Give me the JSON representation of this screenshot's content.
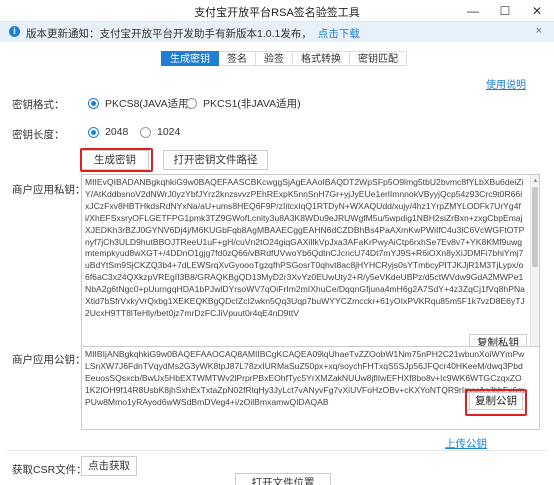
{
  "window": {
    "title": "支付宝开放平台RSA签名验签工具",
    "minimize_glyph": "—",
    "maximize_glyph": "☐",
    "close_glyph": "✕"
  },
  "notice": {
    "text": "版本更新通知：支付宝开放平台开发助手有新版本1.0.1发布，",
    "link": "点击下载",
    "close_glyph": "×"
  },
  "tabs": [
    {
      "label": "生成密钥",
      "active": true
    },
    {
      "label": "签名",
      "active": false
    },
    {
      "label": "验签",
      "active": false
    },
    {
      "label": "格式转换",
      "active": false
    },
    {
      "label": "密钥匹配",
      "active": false
    }
  ],
  "help_link": "使用说明",
  "key_format": {
    "label": "密钥格式：",
    "options": [
      {
        "label": "PKCS8(JAVA适用)",
        "selected": true
      },
      {
        "label": "PKCS1(非JAVA适用)",
        "selected": false
      }
    ]
  },
  "key_length": {
    "label": "密钥长度：",
    "options": [
      {
        "label": "2048",
        "selected": true
      },
      {
        "label": "1024",
        "selected": false
      }
    ]
  },
  "buttons": {
    "generate": "生成密钥",
    "open_path": "打开密钥文件路径",
    "copy_private": "复制私钥",
    "copy_public": "复制公钥",
    "get_csr": "点击获取",
    "open_file_location": "打开文件位置"
  },
  "private_key": {
    "label": "商户应用私钥：",
    "value": "MIIEvQIBADANBgkqhkiG9w0BAQEFAASCBKcwggSjAgEAAoIBAQDT2WpSFp5O9lmg5tbU2bvmc8fYLbXBu6deiZiY/AtKddbsnoV2dNWrJ0yzYbfJYrz2knzsvvzPEhRExpK5nnSnH7Gr+yjJyEUe1erlImnnokVByyjQcp54z93Crc9t0R66ixJCzFxv8HBTHkdsRdNYxNa/aU+ums8HEQ6F9P/zIitcxIqQ1RTDyN+WXAQUdd/xujy/4hz1YrpZMYLODFk7UrYg4fi/XhEFSxsryOFLGETFPG1pmk3TZ9GWofLcnity3u8A3K8WDu9eJRUWgfM5u/5wpdig1NBH2siZrBxn+zxgCbpEmajXJEDKh3rBZJ0GYNV6Dj4j/M6KUGbFqb8AgMBAAECggEAHN6dCZDBhBs4PaAXmKwPWiIfC4u3lC6VcWGFtOTPnyf7jCh3ULD9hutBBOJTReeU1uF+gH/cuVn2tO24giqGAXiIlkVpJxa3AFaKrPwyAiCtp6rxhSe7Ev8v7+YK8KMf9uwgmtempkyud8wXGT+/4DDnO1gjg7fd0zQ66/vBRdfUVwoYb6QdtnCJcncU74Dt7mYJ9S+R6iOXn8yXiJDMFi7bhiYmj7uBdYtSm9SjCKZQ3b4+7dLEWSrqXvGyoooTgzqfhPSGosrT0qhvt8ac8jHYHCRyjs0sYTmbcyPITJKJjR1M3TjLypx/o6f6aC3x24QXkzpVREgII3B8/GRAQKBgQD13MyD2r3XvYz0EUwUty2+R/y5eVKdeUBPz/d5ctWVdw9GdA2MWPe1NbA2g6tNgc0+pUurngqHDA1bPJwlDYrsoWV7qOiFrIm2mIXhuCe/DqqnGfjuna4mH6g2A7SdY+4z3ZqCj1fVq8hPNaXtid7bSfrVxkyVrQxbg1XEKEQKBgQDcIZcI2wkn5Qq3Uqp7buWYYCZmcckr+61yOIxPVKRqu85m5F1k7vzD8E6yTJ2UcxH9TT8lTeHly/bet0jz7mrDzFCJiVpuut0r4qE4nD9ttV"
  },
  "public_key": {
    "label": "商户应用公钥：",
    "value": "MIIBIjANBgkqhkiG9w0BAQEFAAOCAQ8AMIIBCgKCAQEA09lqUhaeTvZZOobW1Nm75nPH2C21wbunXoiWYmPwLSnXW7J6FdnTVqydMs2G3yWK8tpJ87L78zxIURMaSuZ50px+xq/soychFHTxqS5SJp56JFQcr40HKeeM/dwq3PbdEeuosSQsxcb/BwUx5HbEXTWMTWv2lPrprPBxEOhfTyc5YrXMZakNUUw8jflIwEFHXf8bo8v+Ic9WK6WTGCzqxZO1K2IOH9f14R8UsbK8jhSxhExTxtaZpN02fRlqHy3JyLct7vANyvFg7vXiUVFoHzOBv+cKXYoNTQR9rImarAsJbhFx6mPUw8Mmo1yRAyod6wWSdBmDVeg4+i/zOilBmxamwQIDAQAB"
  },
  "upload_link": "上传公钥",
  "csr": {
    "label": "获取CSR文件："
  }
}
